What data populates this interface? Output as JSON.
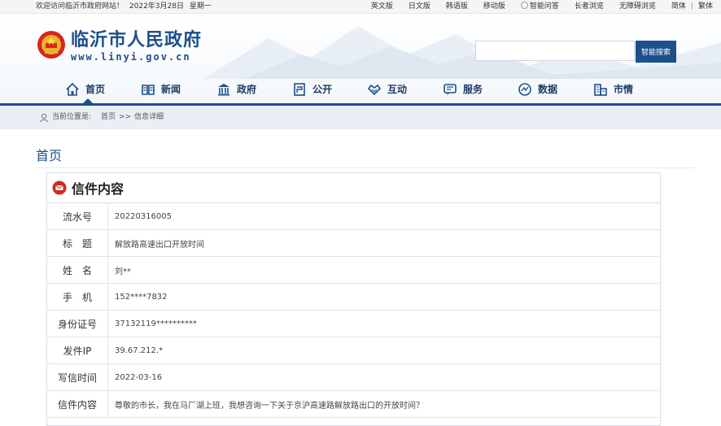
{
  "topbar": {
    "welcome": "欢迎访问临沂市政府网站！",
    "date": "2022年3月28日",
    "weekday": "星期一",
    "links": [
      "英文版",
      "日文版",
      "韩语版",
      "移动版",
      "智能问答",
      "长者浏览",
      "无障碍浏览",
      "简体",
      "繁体"
    ],
    "separator": "|"
  },
  "header": {
    "title": "临沂市人民政府",
    "domain": "www.linyi.gov.cn",
    "search_button": "智能搜索",
    "search_placeholder": ""
  },
  "nav": {
    "items": [
      {
        "label": "首页",
        "icon": "home-icon"
      },
      {
        "label": "新闻",
        "icon": "news-icon"
      },
      {
        "label": "政府",
        "icon": "government-building-icon"
      },
      {
        "label": "公开",
        "icon": "open-document-icon"
      },
      {
        "label": "互动",
        "icon": "interaction-icon"
      },
      {
        "label": "服务",
        "icon": "service-icon"
      },
      {
        "label": "数据",
        "icon": "data-icon"
      },
      {
        "label": "市情",
        "icon": "city-icon"
      }
    ],
    "active": "首页",
    "accent_color": "#1c4f8c"
  },
  "breadcrumb": {
    "prefix": "当前位置是:",
    "home": "首页",
    "separator": ">>",
    "current": "信息详细"
  },
  "section": {
    "title": "首页"
  },
  "letter": {
    "heading": "信件内容",
    "rows": [
      {
        "label": "流水号",
        "value": "20220316005"
      },
      {
        "label": "标　题",
        "value": "解放路高速出口开放时间"
      },
      {
        "label": "姓　名",
        "value": "刘**"
      },
      {
        "label": "手　机",
        "value": "152****7832"
      },
      {
        "label": "身份证号",
        "value": "37132119**********"
      },
      {
        "label": "发件IP",
        "value": "39.67.212.*"
      },
      {
        "label": "写信时间",
        "value": "2022-03-16"
      },
      {
        "label": "信件内容",
        "value": "尊敬的市长，我在马厂湖上班，我想咨询一下关于京沪高速路解放路出口的开放时间？"
      }
    ]
  }
}
